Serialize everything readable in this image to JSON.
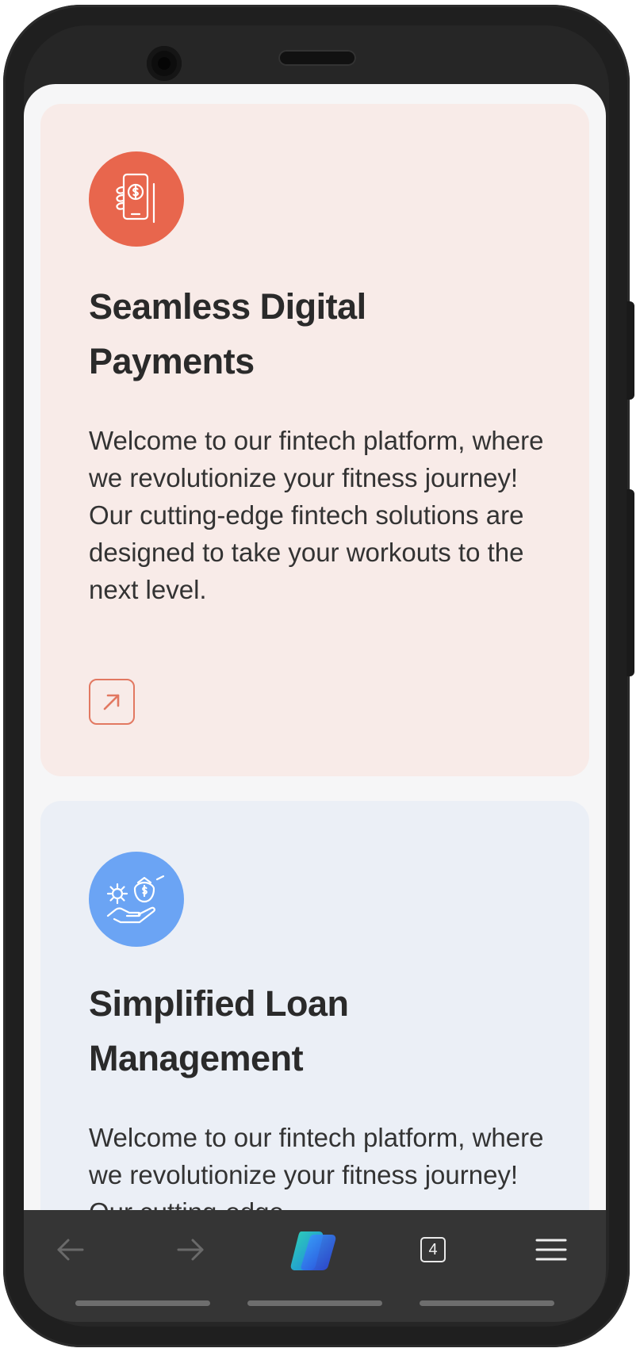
{
  "cards": [
    {
      "title": "Seamless Digital Payments",
      "body": "Welcome to our fintech platform, where we revolutionize your fitness journey! Our cutting-edge fintech solutions are designed to take your workouts to the next level.",
      "icon": "mobile-payment-icon",
      "accent": "#e8664d",
      "background": "#f8ebe8"
    },
    {
      "title": "Simplified Loan Management",
      "body": "Welcome to our fintech platform, where we revolutionize your fitness journey! Our cutting-edge",
      "icon": "loan-hand-gear-icon",
      "accent": "#6ba4f4",
      "background": "#ebeff6"
    }
  ],
  "browser_nav": {
    "tab_count": "4",
    "icons": [
      "back-arrow-icon",
      "forward-arrow-icon",
      "copilot-icon",
      "tabs-icon",
      "menu-icon"
    ]
  },
  "colors": {
    "frame": "#1f1f1f",
    "navbar": "#353535"
  }
}
